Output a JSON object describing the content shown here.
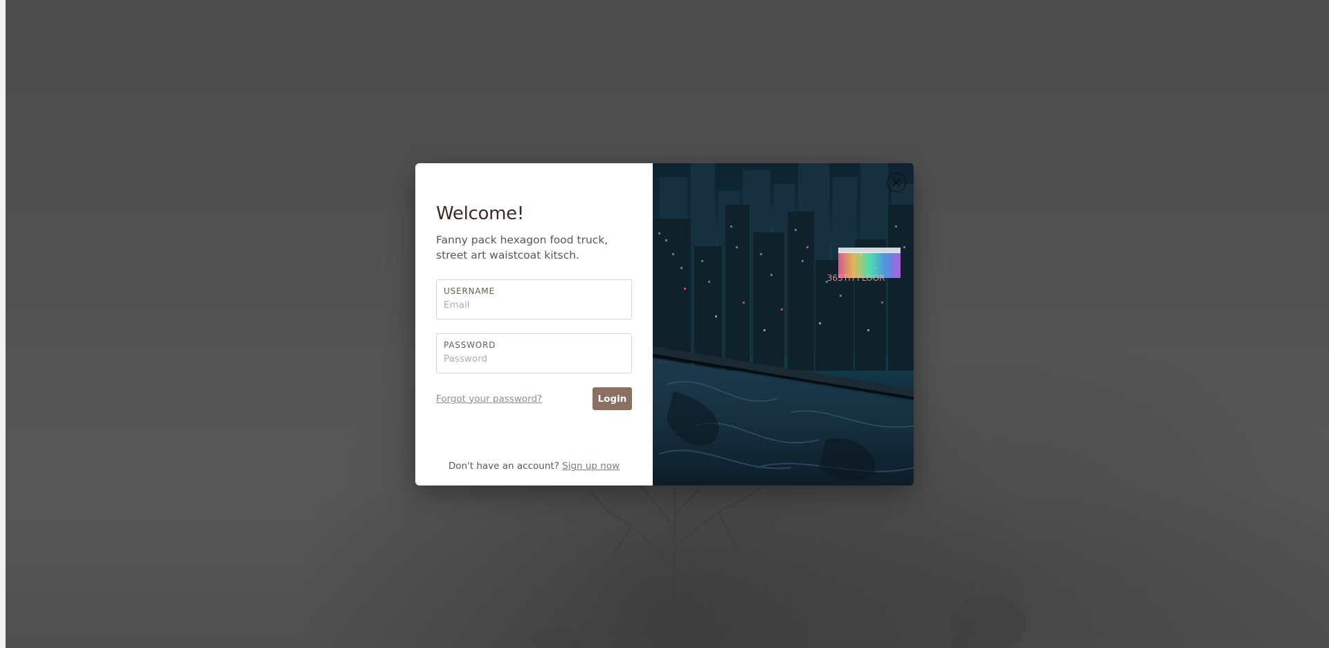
{
  "modal": {
    "title": "Welcome!",
    "subtitle": "Fanny pack hexagon food truck, street art waistcoat kitsch.",
    "username": {
      "label": "USERNAME",
      "placeholder": "Email",
      "value": ""
    },
    "password": {
      "label": "PASSWORD",
      "placeholder": "Password",
      "value": ""
    },
    "forgot_link": "Forgot your password?",
    "login_label": "Login",
    "signup_prompt": "Don't have an account?",
    "signup_link": "Sign up now",
    "image_sign_text": "365TH FLOOR",
    "close_icon": "close-icon"
  },
  "colors": {
    "accent_button": "#8a6f63",
    "heading": "#3b2a23",
    "overlay": "#4b4b4b"
  }
}
